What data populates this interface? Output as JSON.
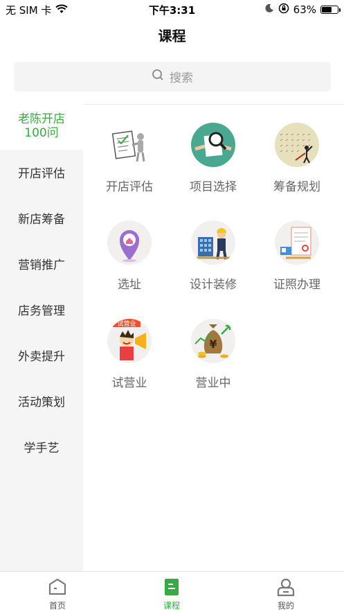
{
  "status_bar": {
    "carrier": "无 SIM 卡",
    "time": "下午3:31",
    "battery_percent": "63%",
    "battery_level": 0.63
  },
  "nav": {
    "title": "课程"
  },
  "search": {
    "placeholder": "搜索"
  },
  "sidebar": {
    "items": [
      {
        "label": "老陈开店\n100问",
        "active": true
      },
      {
        "label": "开店评估"
      },
      {
        "label": "新店筹备"
      },
      {
        "label": "营销推广"
      },
      {
        "label": "店务管理"
      },
      {
        "label": "外卖提升"
      },
      {
        "label": "活动策划"
      },
      {
        "label": "学手艺"
      }
    ]
  },
  "grid": {
    "items": [
      {
        "label": "开店评估",
        "icon": "checklist-person-icon"
      },
      {
        "label": "项目选择",
        "icon": "magnifier-paper-icon"
      },
      {
        "label": "筹备规划",
        "icon": "planning-drawing-icon"
      },
      {
        "label": "选址",
        "icon": "location-pin-icon"
      },
      {
        "label": "设计装修",
        "icon": "construction-worker-icon"
      },
      {
        "label": "证照办理",
        "icon": "certificate-icon"
      },
      {
        "label": "试营业",
        "icon": "megaphone-boy-icon",
        "badge": "试营业"
      },
      {
        "label": "营业中",
        "icon": "money-bag-icon"
      }
    ]
  },
  "tab_bar": {
    "tabs": [
      {
        "label": "首页",
        "icon": "home-icon"
      },
      {
        "label": "课程",
        "icon": "course-book-icon",
        "active": true
      },
      {
        "label": "我的",
        "icon": "profile-icon"
      }
    ]
  },
  "colors": {
    "accent": "#3aa845",
    "sidebar_bg": "#f5f5f5",
    "search_bg": "#f4f4f4"
  }
}
